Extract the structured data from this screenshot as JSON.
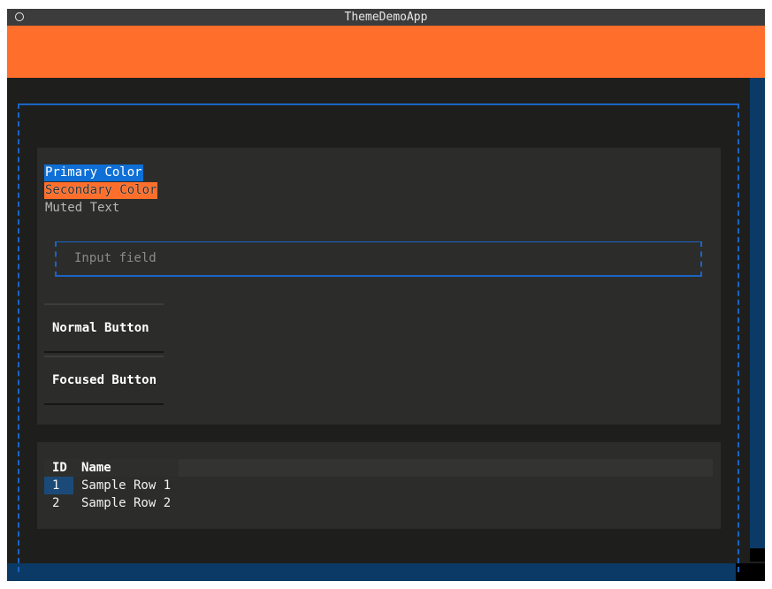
{
  "window": {
    "title": "ThemeDemoApp"
  },
  "labels": {
    "primary": "Primary Color",
    "secondary": "Secondary Color",
    "muted": "Muted Text"
  },
  "input": {
    "placeholder": "Input field"
  },
  "buttons": {
    "normal": "Normal Button",
    "focused": "Focused Button"
  },
  "table": {
    "columns": [
      "ID",
      "Name"
    ],
    "rows": [
      {
        "id": "1",
        "name": "Sample Row 1"
      },
      {
        "id": "2",
        "name": "Sample Row 2"
      }
    ]
  },
  "colors": {
    "primary": "#0f6fd6",
    "secondary": "#ff6e2a",
    "background": "#1e1f1d",
    "surface": "#2c2d2b",
    "accent_border": "#1a64c4"
  },
  "icons": {
    "title_icon": "circle-icon"
  }
}
